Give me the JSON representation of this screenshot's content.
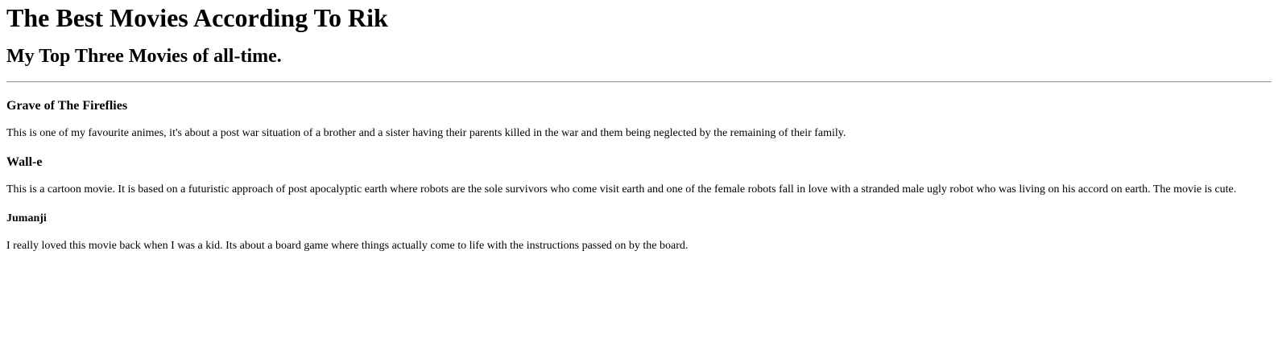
{
  "page": {
    "title": "The Best Movies According To Rik",
    "subtitle": "My Top Three Movies of all-time."
  },
  "movies": [
    {
      "title": "Grave of The Fireflies",
      "description": "This is one of my favourite animes, it's about a post war situation of a brother and a sister having their parents killed in the war and them being neglected by the remaining of their family."
    },
    {
      "title": "Wall-e",
      "description": "This is a cartoon movie. It is based on a futuristic approach of post apocalyptic earth where robots are the sole survivors who come visit earth and one of the female robots fall in love with a stranded male ugly robot who was living on his accord on earth. The movie is cute."
    },
    {
      "title": "Jumanji",
      "description": "I really loved this movie back when I was a kid. Its about a board game where things actually come to life with the instructions passed on by the board."
    }
  ]
}
